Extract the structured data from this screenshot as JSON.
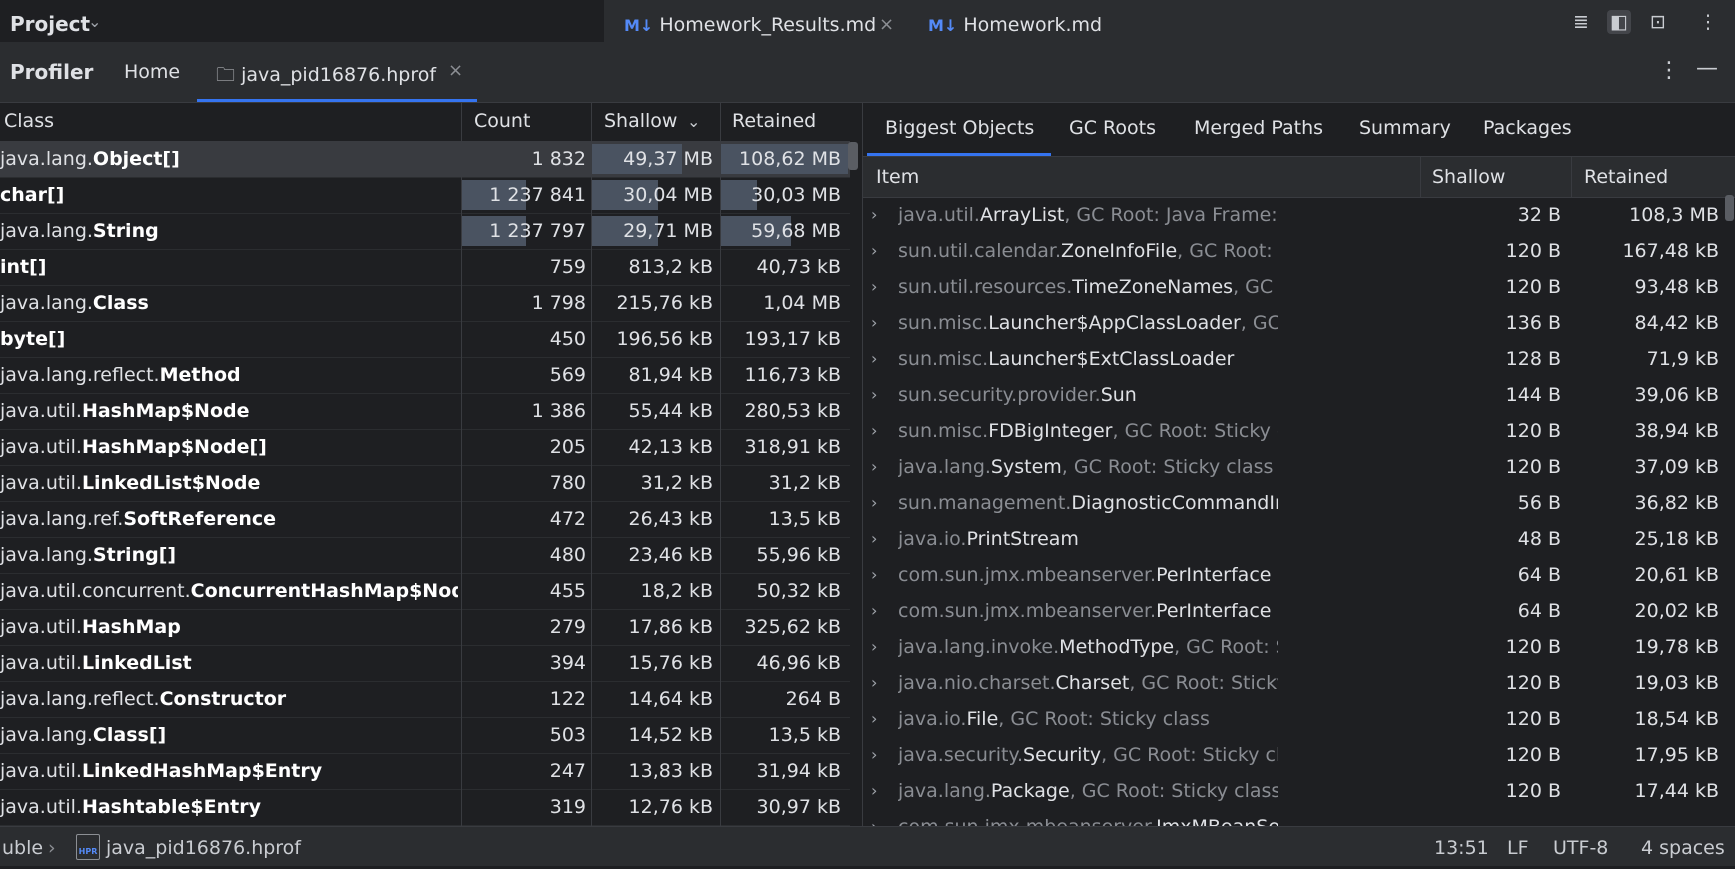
{
  "window": {
    "project_label": "Project"
  },
  "editor_tabs": [
    {
      "icon": "M↓",
      "label": "Homework_Results.md",
      "close": "×"
    },
    {
      "icon": "M↓",
      "label": "Homework.md"
    }
  ],
  "profiler": {
    "title": "Profiler",
    "home_tab": "Home",
    "file_tab": "java_pid16876.hprof",
    "close": "×"
  },
  "left_table": {
    "headers": {
      "class": "Class",
      "count": "Count",
      "shallow": "Shallow",
      "retained": "Retained"
    },
    "sort": {
      "column": "shallow",
      "direction": "descending"
    },
    "rows": [
      {
        "pkg": "java.lang.",
        "name": "Object[]",
        "count": "1 832",
        "shallow": "49,37 MB",
        "retained": "108,62 MB",
        "count_bar": 0.0,
        "shallow_bar": 1.0,
        "retained_bar": 1.0
      },
      {
        "pkg": "",
        "name": "char[]",
        "count": "1 237 841",
        "shallow": "30,04 MB",
        "retained": "30,03 MB",
        "count_bar": 1.0,
        "shallow_bar": 0.6,
        "retained_bar": 0.28
      },
      {
        "pkg": "java.lang.",
        "name": "String",
        "count": "1 237 797",
        "shallow": "29,71 MB",
        "retained": "59,68 MB",
        "count_bar": 1.0,
        "shallow_bar": 0.6,
        "retained_bar": 0.55
      },
      {
        "pkg": "",
        "name": "int[]",
        "count": "759",
        "shallow": "813,2 kB",
        "retained": "40,73 kB"
      },
      {
        "pkg": "java.lang.",
        "name": "Class",
        "count": "1 798",
        "shallow": "215,76 kB",
        "retained": "1,04 MB"
      },
      {
        "pkg": "",
        "name": "byte[]",
        "count": "450",
        "shallow": "196,56 kB",
        "retained": "193,17 kB"
      },
      {
        "pkg": "java.lang.reflect.",
        "name": "Method",
        "count": "569",
        "shallow": "81,94 kB",
        "retained": "116,73 kB"
      },
      {
        "pkg": "java.util.",
        "name": "HashMap$Node",
        "count": "1 386",
        "shallow": "55,44 kB",
        "retained": "280,53 kB"
      },
      {
        "pkg": "java.util.",
        "name": "HashMap$Node[]",
        "count": "205",
        "shallow": "42,13 kB",
        "retained": "318,91 kB"
      },
      {
        "pkg": "java.util.",
        "name": "LinkedList$Node",
        "count": "780",
        "shallow": "31,2 kB",
        "retained": "31,2 kB"
      },
      {
        "pkg": "java.lang.ref.",
        "name": "SoftReference",
        "count": "472",
        "shallow": "26,43 kB",
        "retained": "13,5 kB"
      },
      {
        "pkg": "java.lang.",
        "name": "String[]",
        "count": "480",
        "shallow": "23,46 kB",
        "retained": "55,96 kB"
      },
      {
        "pkg": "java.util.concurrent.",
        "name": "ConcurrentHashMap$Node",
        "count": "455",
        "shallow": "18,2 kB",
        "retained": "50,32 kB"
      },
      {
        "pkg": "java.util.",
        "name": "HashMap",
        "count": "279",
        "shallow": "17,86 kB",
        "retained": "325,62 kB"
      },
      {
        "pkg": "java.util.",
        "name": "LinkedList",
        "count": "394",
        "shallow": "15,76 kB",
        "retained": "46,96 kB"
      },
      {
        "pkg": "java.lang.reflect.",
        "name": "Constructor",
        "count": "122",
        "shallow": "14,64 kB",
        "retained": "264 B"
      },
      {
        "pkg": "java.lang.",
        "name": "Class[]",
        "count": "503",
        "shallow": "14,52 kB",
        "retained": "13,5 kB"
      },
      {
        "pkg": "java.util.",
        "name": "LinkedHashMap$Entry",
        "count": "247",
        "shallow": "13,83 kB",
        "retained": "31,94 kB"
      },
      {
        "pkg": "java.util.",
        "name": "Hashtable$Entry",
        "count": "319",
        "shallow": "12,76 kB",
        "retained": "30,97 kB"
      }
    ]
  },
  "right_panel": {
    "tabs": [
      "Biggest Objects",
      "GC Roots",
      "Merged Paths",
      "Summary",
      "Packages"
    ],
    "headers": {
      "item": "Item",
      "shallow": "Shallow",
      "retained": "Retained"
    },
    "rows": [
      {
        "pkg": "java.util.",
        "name": "ArrayList",
        "suffix": ", GC Root: Java Frame: java.util.ArrayList",
        "shallow": "32 B",
        "retained": "108,3 MB"
      },
      {
        "pkg": "sun.util.calendar.",
        "name": "ZoneInfoFile",
        "suffix": ", GC Root: Sticky class",
        "shallow": "120 B",
        "retained": "167,48 kB"
      },
      {
        "pkg": "sun.util.resources.",
        "name": "TimeZoneNames",
        "suffix": ", GC Root: Sticky class",
        "shallow": "120 B",
        "retained": "93,48 kB"
      },
      {
        "pkg": "sun.misc.",
        "name": "Launcher$AppClassLoader",
        "suffix": ", GC Root: Java Frame",
        "shallow": "136 B",
        "retained": "84,42 kB"
      },
      {
        "pkg": "sun.misc.",
        "name": "Launcher$ExtClassLoader",
        "suffix": "",
        "shallow": "128 B",
        "retained": "71,9 kB"
      },
      {
        "pkg": "sun.security.provider.",
        "name": "Sun",
        "suffix": "",
        "shallow": "144 B",
        "retained": "39,06 kB"
      },
      {
        "pkg": "sun.misc.",
        "name": "FDBigInteger",
        "suffix": ", GC Root: Sticky class",
        "shallow": "120 B",
        "retained": "38,94 kB"
      },
      {
        "pkg": "java.lang.",
        "name": "System",
        "suffix": ", GC Root: Sticky class",
        "shallow": "120 B",
        "retained": "37,09 kB"
      },
      {
        "pkg": "sun.management.",
        "name": "DiagnosticCommandImpl",
        "suffix": "",
        "shallow": "56 B",
        "retained": "36,82 kB"
      },
      {
        "pkg": "java.io.",
        "name": "PrintStream",
        "suffix": "",
        "shallow": "48 B",
        "retained": "25,18 kB"
      },
      {
        "pkg": "com.sun.jmx.mbeanserver.",
        "name": "PerInterface",
        "suffix": "",
        "shallow": "64 B",
        "retained": "20,61 kB"
      },
      {
        "pkg": "com.sun.jmx.mbeanserver.",
        "name": "PerInterface",
        "suffix": "",
        "shallow": "64 B",
        "retained": "20,02 kB"
      },
      {
        "pkg": "java.lang.invoke.",
        "name": "MethodType",
        "suffix": ", GC Root: Sticky class",
        "shallow": "120 B",
        "retained": "19,78 kB"
      },
      {
        "pkg": "java.nio.charset.",
        "name": "Charset",
        "suffix": ", GC Root: Sticky class",
        "shallow": "120 B",
        "retained": "19,03 kB"
      },
      {
        "pkg": "java.io.",
        "name": "File",
        "suffix": ", GC Root: Sticky class",
        "shallow": "120 B",
        "retained": "18,54 kB"
      },
      {
        "pkg": "java.security.",
        "name": "Security",
        "suffix": ", GC Root: Sticky class",
        "shallow": "120 B",
        "retained": "17,95 kB"
      },
      {
        "pkg": "java.lang.",
        "name": "Package",
        "suffix": ", GC Root: Sticky class",
        "shallow": "120 B",
        "retained": "17,44 kB"
      },
      {
        "pkg": "com.sun.jmx.mbeanserver.",
        "name": "JmxMBeanServer",
        "suffix": "",
        "shallow": "",
        "retained": ""
      }
    ]
  },
  "status_bar": {
    "breadcrumb_prefix": "uble",
    "breadcrumb_sep": "›",
    "file_icon_label": "HPR",
    "file": "java_pid16876.hprof",
    "position": "13:51",
    "line_sep": "LF",
    "encoding": "UTF-8",
    "indent": "4 spaces"
  },
  "colors": {
    "accent": "#3574f0",
    "bg": "#1e1f22",
    "panel": "#2b2d30",
    "bar": "#4a5361"
  }
}
